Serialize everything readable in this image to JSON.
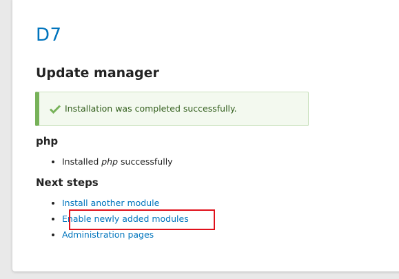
{
  "site_name": "D7",
  "page_title": "Update manager",
  "status_message": {
    "text": "Installation was completed successfully.",
    "icon": "check-icon",
    "color": "#77b259"
  },
  "project": {
    "heading": "php",
    "result_prefix": "Installed ",
    "result_name": "php",
    "result_suffix": " successfully"
  },
  "next_steps": {
    "heading": "Next steps",
    "links": [
      "Install another module",
      "Enable newly added modules",
      "Administration pages"
    ]
  },
  "highlight_color": "#e0101a"
}
